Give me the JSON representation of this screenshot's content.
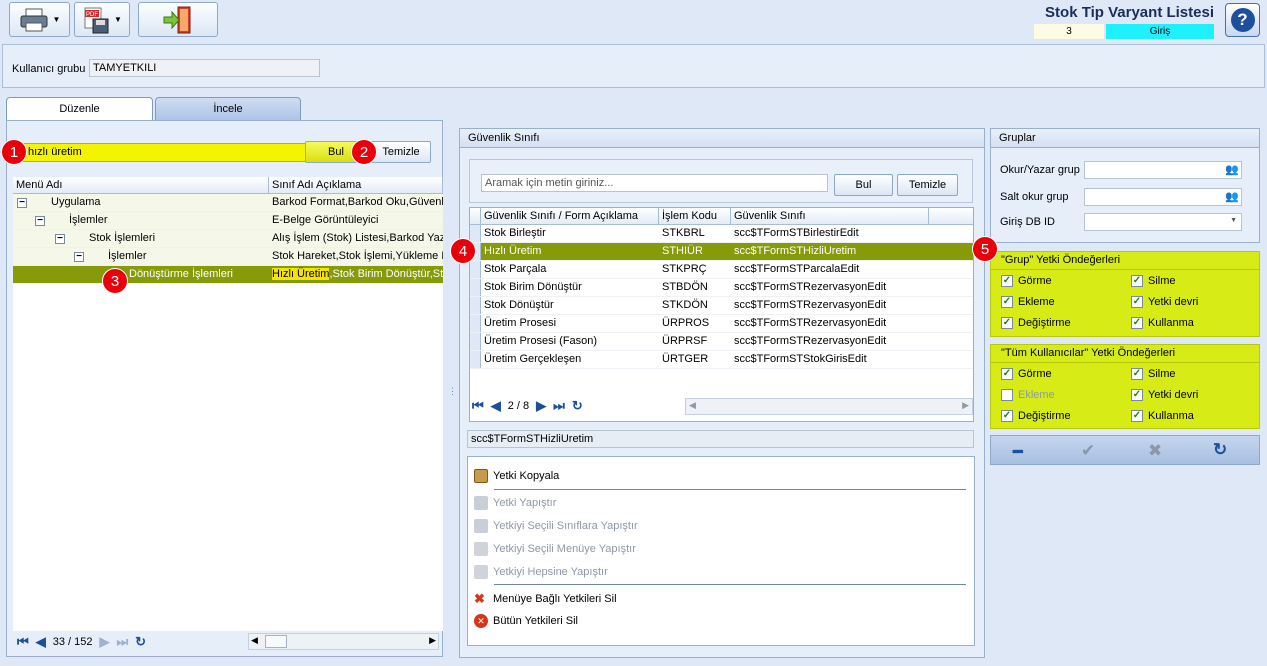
{
  "header": {
    "title": "Stok Tip Varyant Listesi",
    "number": "3",
    "mode": "Giriş",
    "help": "?"
  },
  "user_group": {
    "label": "Kullanıcı grubu",
    "value": "TAMYETKILI"
  },
  "tabs": [
    "Düzenle",
    "İncele"
  ],
  "left": {
    "search_value": "hızlı üretim",
    "find_button": "Bul",
    "clear_button": "Temizle",
    "columns": [
      "Menü Adı",
      "Sınıf Adı Açıklama"
    ],
    "rows": [
      {
        "name": "Uygulama",
        "desc": "Barkod Format,Barkod Oku,Güvenlik"
      },
      {
        "name": "İşlemler",
        "desc": "E-Belge Görüntüleyici"
      },
      {
        "name": "Stok İşlemleri",
        "desc": "Alış İşlem (Stok) Listesi,Barkod Yazd"
      },
      {
        "name": "İşlemler",
        "desc": "Stok Hareket,Stok İşlemi,Yükleme P"
      },
      {
        "name": "Dönüştürme İşlemleri",
        "desc_highlight": "Hızlı Üretim",
        "desc": ",Stok Birim Dönüştür,Stok"
      }
    ],
    "nav_position": "33 / 152"
  },
  "security": {
    "title": "Güvenlik Sınıfı",
    "search_placeholder": "Aramak için metin giriniz...",
    "find_button": "Bul",
    "clear_button": "Temizle",
    "columns": [
      "Güvenlik Sınıfı / Form Açıklama",
      "İşlem Kodu",
      "Güvenlik Sınıfı"
    ],
    "rows": [
      {
        "name": "Stok Birleştir",
        "code": "STKBRL",
        "cls": "scc$TFormSTBirlestirEdit"
      },
      {
        "name": "Hızlı Üretim",
        "code": "STHIÜR",
        "cls": "scc$TFormSTHizliUretim"
      },
      {
        "name": "Stok Parçala",
        "code": "STKPRÇ",
        "cls": "scc$TFormSTParcalaEdit"
      },
      {
        "name": "Stok Birim Dönüştür",
        "code": "STBDÖN",
        "cls": "scc$TFormSTRezervasyonEdit"
      },
      {
        "name": "Stok Dönüştür",
        "code": "STKDÖN",
        "cls": "scc$TFormSTRezervasyonEdit"
      },
      {
        "name": "Üretim Prosesi",
        "code": "ÜRPROS",
        "cls": "scc$TFormSTRezervasyonEdit"
      },
      {
        "name": "Üretim Prosesi (Fason)",
        "code": "ÜRPRSF",
        "cls": "scc$TFormSTRezervasyonEdit"
      },
      {
        "name": "Üretim Gerçekleşen",
        "code": "ÜRTGER",
        "cls": "scc$TFormSTStokGirisEdit"
      }
    ],
    "nav_position": "2 / 8",
    "selected_class": "scc$TFormSTHizliUretim"
  },
  "actions": {
    "copy": "Yetki Kopyala",
    "paste": "Yetki Yapıştır",
    "paste_classes": "Yetkiyi Seçili Sınıflara Yapıştır",
    "paste_menu": "Yetkiyi Seçili Menüye Yapıştır",
    "paste_all": "Yetkiyi Hepsine Yapıştır",
    "delete_menu": "Menüye Bağlı Yetkileri Sil",
    "delete_all": "Bütün Yetkileri Sil"
  },
  "groups": {
    "title": "Gruplar",
    "rw_label": "Okur/Yazar grup",
    "ro_label": "Salt okur grup",
    "db_label": "Giriş DB ID"
  },
  "group_perms": {
    "title": "\"Grup\" Yetki Öndeğerleri",
    "items": [
      {
        "label": "Görme",
        "checked": true
      },
      {
        "label": "Silme",
        "checked": true
      },
      {
        "label": "Ekleme",
        "checked": true
      },
      {
        "label": "Yetki devri",
        "checked": true
      },
      {
        "label": "Değiştirme",
        "checked": true
      },
      {
        "label": "Kullanma",
        "checked": true
      }
    ]
  },
  "all_perms": {
    "title": "\"Tüm Kullanıcılar\" Yetki Öndeğerleri",
    "items": [
      {
        "label": "Görme",
        "checked": true
      },
      {
        "label": "Silme",
        "checked": true
      },
      {
        "label": "Ekleme",
        "checked": false
      },
      {
        "label": "Yetki devri",
        "checked": true
      },
      {
        "label": "Değiştirme",
        "checked": true
      },
      {
        "label": "Kullanma",
        "checked": true
      }
    ]
  },
  "badges": [
    "1",
    "2",
    "3",
    "4",
    "5"
  ]
}
